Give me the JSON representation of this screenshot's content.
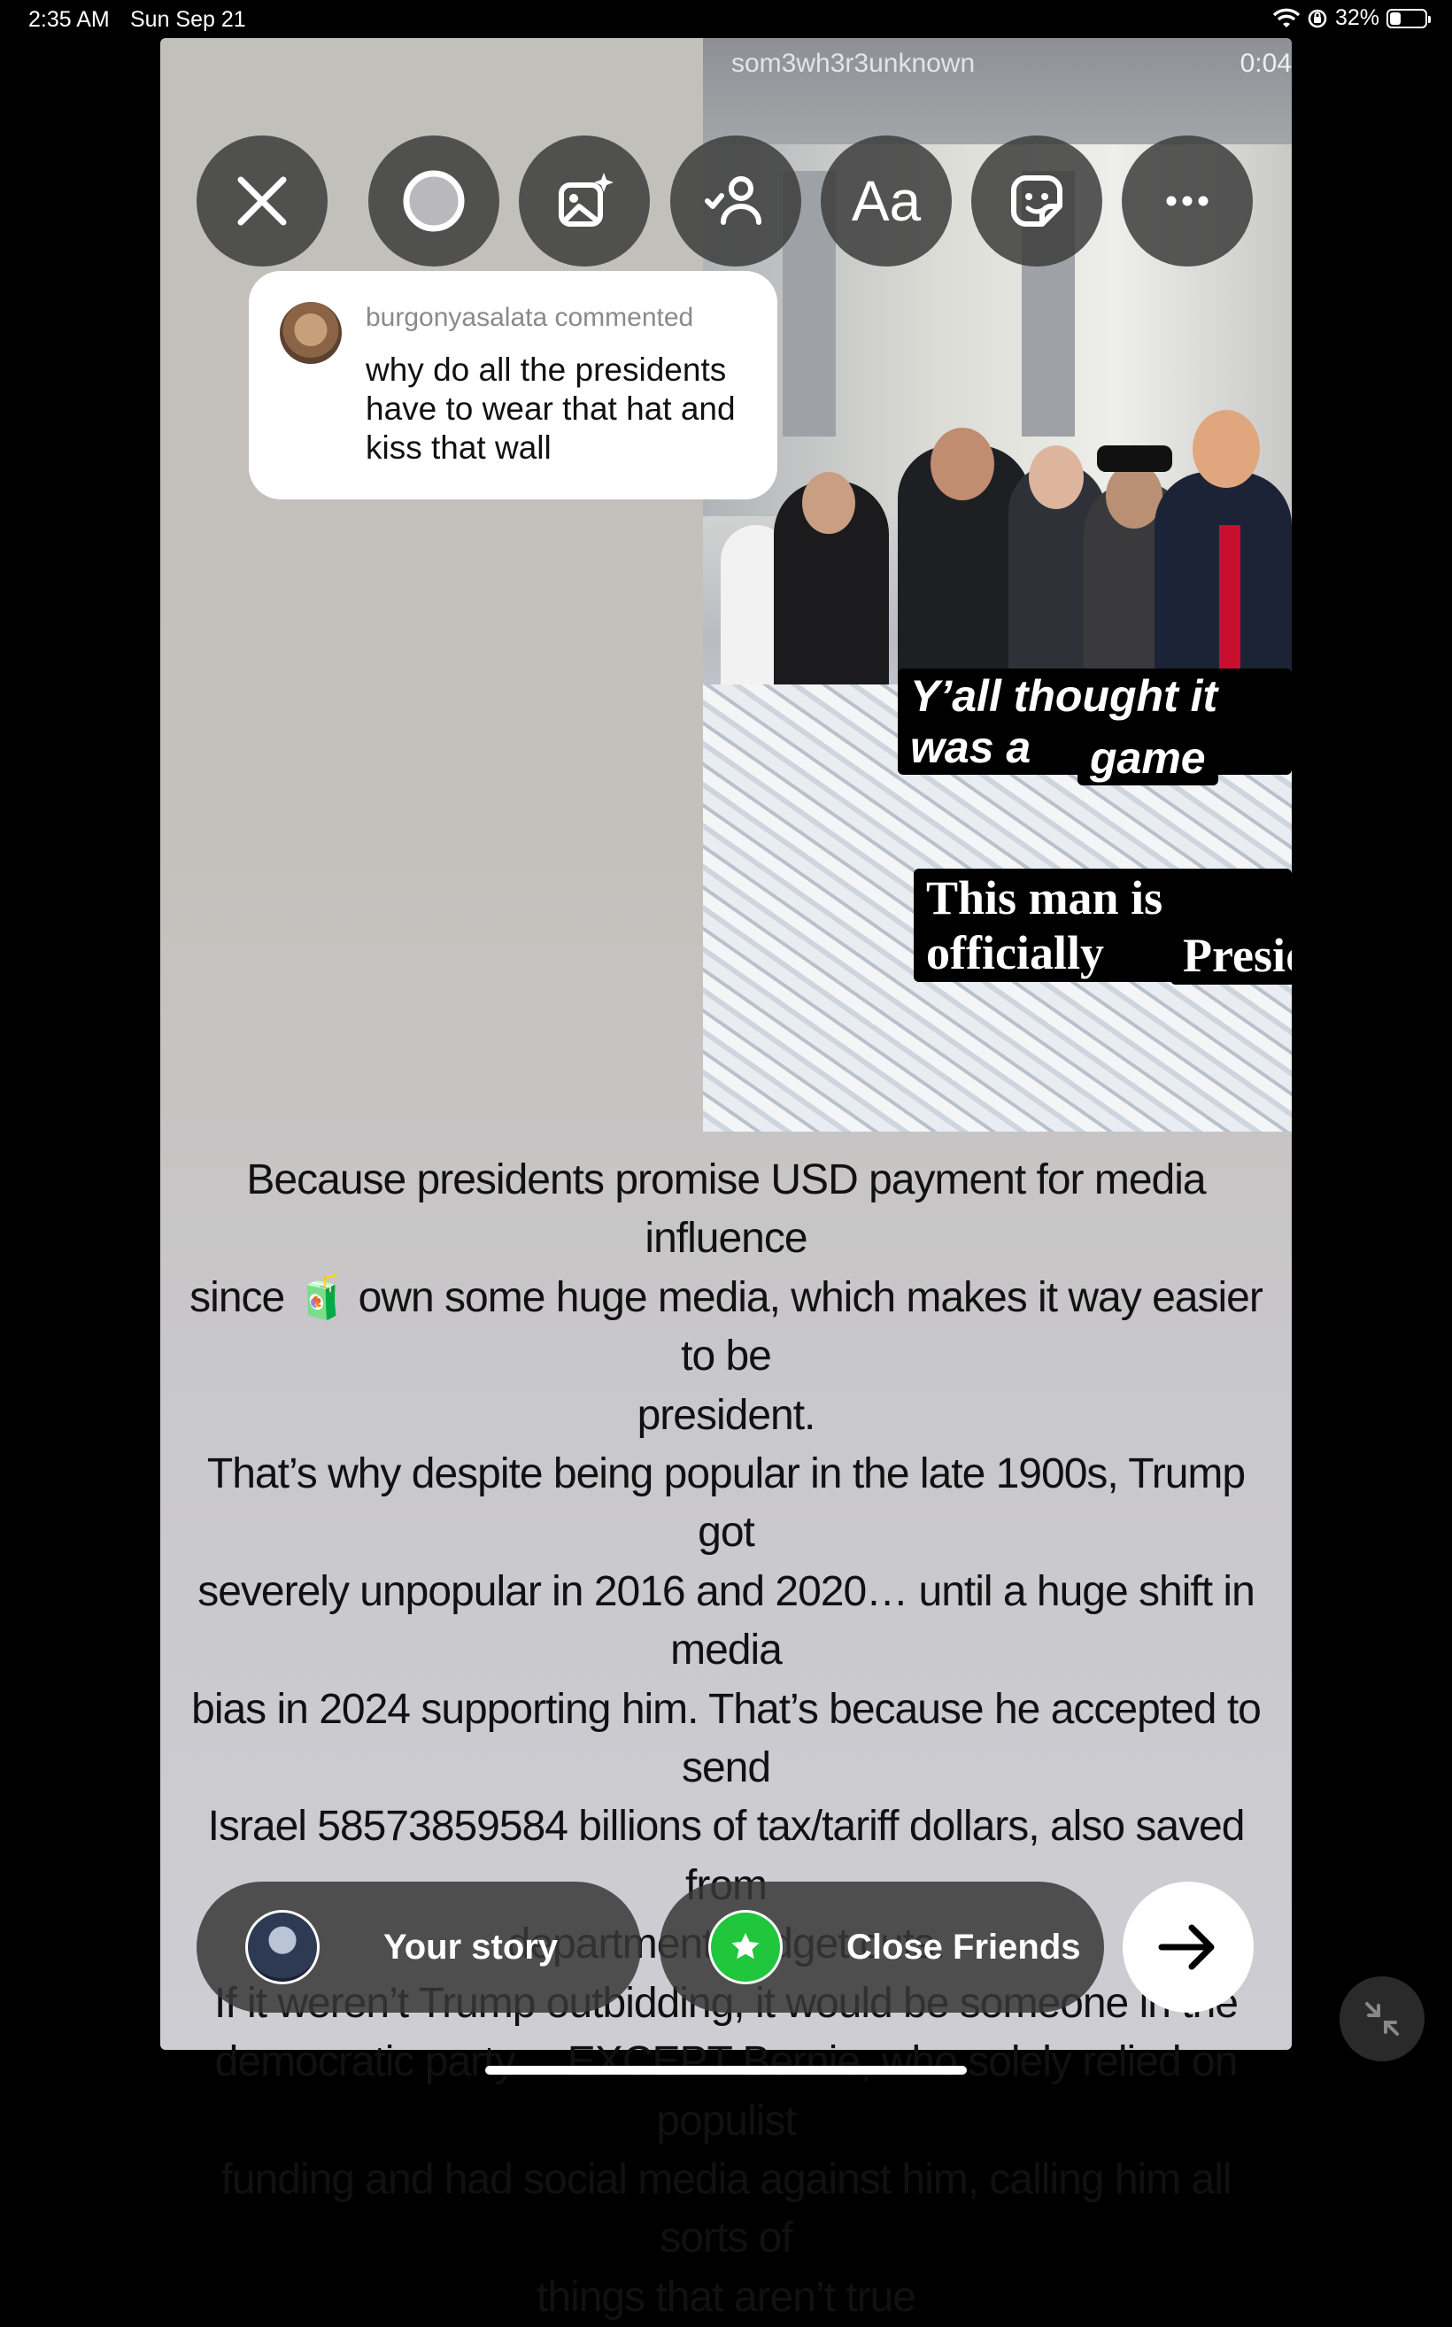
{
  "status_bar": {
    "time": "2:35 AM",
    "date": "Sun Sep 21",
    "battery": "32%",
    "battery_level": 0.32
  },
  "media": {
    "username": "som3wh3r3unknown",
    "timer": "0:04",
    "caption1_line1": "Y’all thought it was a",
    "caption1_line2": "game",
    "caption2_line1": "This man is officially",
    "caption2_line2": "President"
  },
  "toolbar": {
    "text_tool": "Aa"
  },
  "comment": {
    "header": "burgonyasalata commented",
    "text": "why do all the presidents have to wear that hat and kiss that wall"
  },
  "body_text": [
    "Because presidents promise USD payment for media influence",
    "since 🧃 own some huge media, which makes it way easier to be",
    "president.",
    "That’s why despite being popular in the late 1900s, Trump got",
    "severely unpopular in 2016 and 2020… until a huge shift in media",
    "bias in 2024 supporting him. That’s because he accepted to send",
    "Israel 58573859584 billions of tax/tariff dollars, also saved from",
    "department budget cuts.",
    "If it weren’t Trump outbidding, it would be someone in the",
    "democratic party… EXCEPT Bernie, who solely relied on populist",
    "funding and had social media against him, calling him all sorts of",
    "things that aren’t true"
  ],
  "share": {
    "your_story": "Your story",
    "close_friends": "Close Friends"
  },
  "colors": {
    "close_friends_green": "#20c63c",
    "toolbar_bg": "#3c3c3c",
    "tie_red": "#c8102e"
  }
}
